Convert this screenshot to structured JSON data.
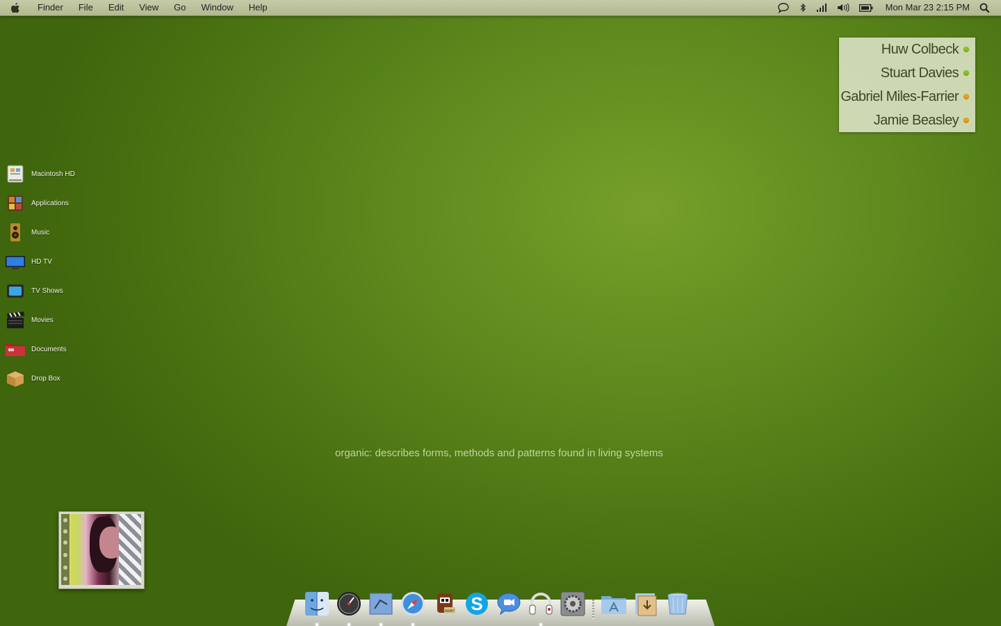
{
  "menubar": {
    "app_name": "Finder",
    "menus": [
      "File",
      "Edit",
      "View",
      "Go",
      "Window",
      "Help"
    ],
    "status_icons": [
      "chat-icon",
      "bluetooth-icon",
      "signal-icon",
      "volume-icon",
      "battery-icon"
    ],
    "clock": "Mon Mar 23  2:15 PM",
    "search_icon": "spotlight-icon"
  },
  "buddies": [
    {
      "name": "Huw Colbeck",
      "status_color": "#8ec31c"
    },
    {
      "name": "Stuart Davies",
      "status_color": "#8ec31c"
    },
    {
      "name": "Gabriel Miles-Farrier",
      "status_color": "#f0a020"
    },
    {
      "name": "Jamie Beasley",
      "status_color": "#f0a020"
    }
  ],
  "shortcuts": [
    {
      "label": "Macintosh HD",
      "icon": "hard-drive-icon"
    },
    {
      "label": "Applications",
      "icon": "applications-icon"
    },
    {
      "label": "Music",
      "icon": "speaker-icon"
    },
    {
      "label": "HD TV",
      "icon": "tv-icon"
    },
    {
      "label": "TV Shows",
      "icon": "tv-shows-icon"
    },
    {
      "label": "Movies",
      "icon": "clapperboard-icon"
    },
    {
      "label": "Documents",
      "icon": "documents-icon"
    },
    {
      "label": "Drop Box",
      "icon": "box-icon"
    }
  ],
  "tagline": "organic: describes forms, methods and patterns found in living systems",
  "dock": {
    "apps": [
      "finder-icon",
      "dashboard-icon",
      "mail-icon",
      "safari-icon",
      "adium-icon",
      "skype-icon",
      "ichat-icon",
      "headphones-icon",
      "system-preferences-icon"
    ],
    "stacks": [
      "applications-folder-icon",
      "downloads-icon",
      "trash-icon"
    ]
  },
  "colors": {
    "desktop_green": "#5e8a1e",
    "menubar": "#bcc39b",
    "widget_bg": "#d6e0c0"
  }
}
